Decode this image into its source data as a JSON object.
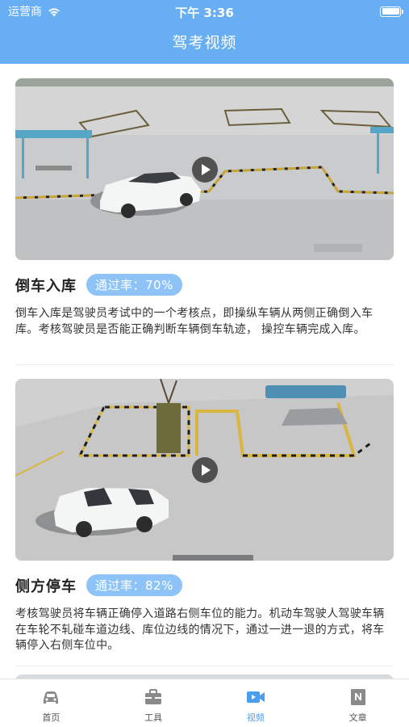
{
  "status_bar": {
    "carrier": "运营商",
    "time": "下午 3:36"
  },
  "nav": {
    "title": "驾考视频"
  },
  "videos": [
    {
      "title": "倒车入库",
      "pass_rate": "通过率：70%",
      "description": "倒车入库是驾驶员考试中的一个考核点，即操纵车辆从两侧正确倒入车库。考核驾驶员是否能正确判断车辆倒车轨迹， 操控车辆完成入库。"
    },
    {
      "title": "侧方停车",
      "pass_rate": "通过率：82%",
      "description": "考核驾驶员将车辆正确停入道路右侧车位的能力。机动车驾驶人驾驶车辆在车轮不轧碰车道边线、库位边线的情况下，通过一进一退的方式，将车辆停入右侧车位中。"
    }
  ],
  "tabs": [
    {
      "label": "首页",
      "icon": "car-icon",
      "active": false
    },
    {
      "label": "工具",
      "icon": "toolbox-icon",
      "active": false
    },
    {
      "label": "视频",
      "icon": "video-camera-icon",
      "active": true
    },
    {
      "label": "文章",
      "icon": "news-icon",
      "active": false
    }
  ],
  "colors": {
    "header": "#67aef3",
    "badge": "#8ec3f7",
    "active_tab": "#4a9ef0"
  }
}
